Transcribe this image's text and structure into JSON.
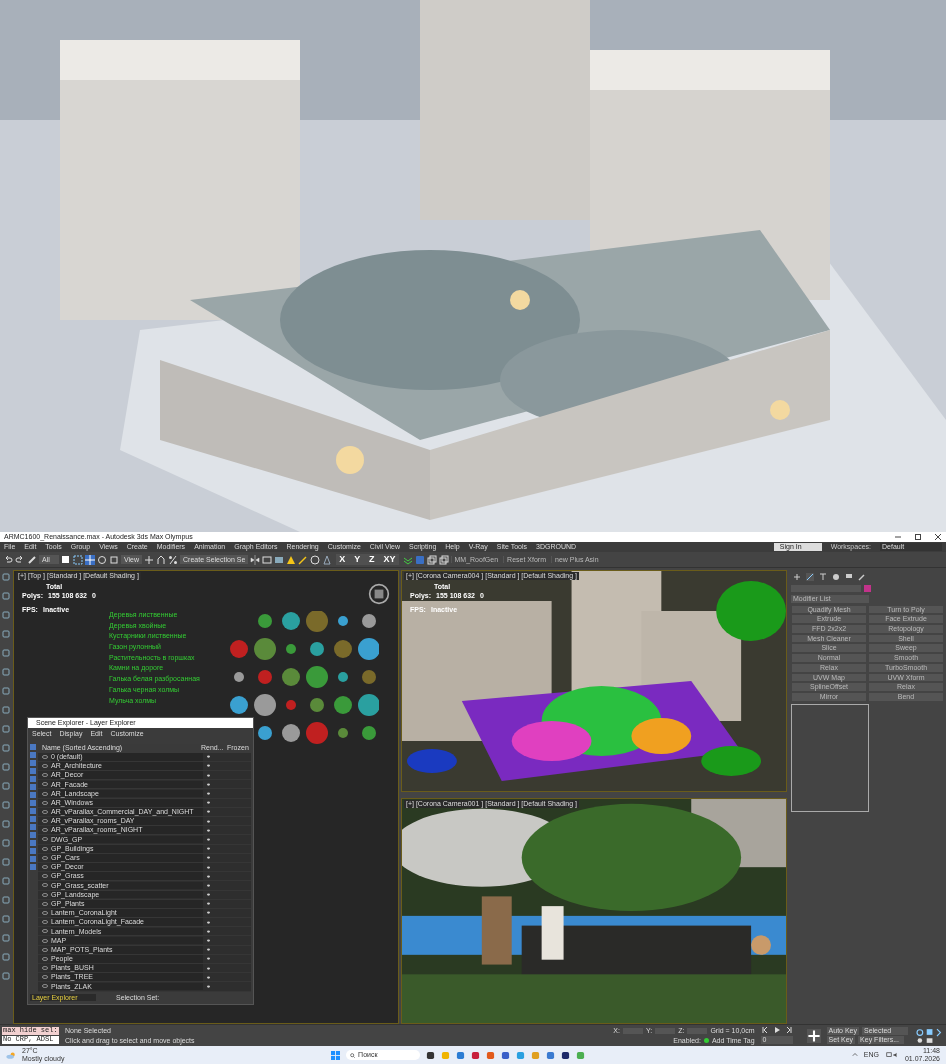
{
  "window": {
    "title": "ARMC1600_Renaissance.max - Autodesk 3ds Max Olympus"
  },
  "menu": [
    "File",
    "Edit",
    "Tools",
    "Group",
    "Views",
    "Create",
    "Modifiers",
    "Animation",
    "Graph Editors",
    "Rendering",
    "Customize",
    "Civil View",
    "Scripting",
    "Help",
    "V-Ray",
    "Site Tools",
    "3DGROUND"
  ],
  "toolbar": {
    "selection_filter": "All",
    "reference": "View",
    "named_selection": "Create Selection Se",
    "axis_constraints": "X  Y  Z  XY",
    "buttons": [
      "MM_RoofGen",
      "Reset Xform",
      "new Plus Asin"
    ]
  },
  "account": {
    "sign_in": "Sign In",
    "workspaces_label": "Workspaces:",
    "workspace": "Default"
  },
  "viewports": [
    {
      "label": "[+] [Top ] [Standard ] [Default Shading ]",
      "total": "Total",
      "polys_label": "Polys:",
      "polys": "155 108 632",
      "polys_sel": "0",
      "fps_label": "FPS:",
      "fps": "Inactive"
    },
    {
      "label": "[+] [Corona Camera004 ] [Standard ] [Default Shading ]",
      "total": "Total",
      "polys_label": "Polys:",
      "polys": "155 108 632",
      "polys_sel": "0",
      "fps_label": "FPS:",
      "fps": "Inactive"
    },
    {
      "label": "[+] [Corona Camera001 ] [Standard ] [Default Shading ]"
    }
  ],
  "plan_labels": [
    "Деревья лиственные",
    "Деревья хвойные",
    "Кустарники лиственные",
    "Газон рулонный",
    "Растительность в горшках",
    "Камни на дороге",
    "Галька белая разбросанная",
    "Галька черная холмы",
    "Мульча холмы"
  ],
  "scene_explorer": {
    "title": "Scene Explorer - Layer Explorer",
    "menu": [
      "Select",
      "Display",
      "Edit",
      "Customize"
    ],
    "columns": [
      "Name (Sorted Ascending)",
      "Rend...",
      "Frozen"
    ],
    "layers": [
      "0 (default)",
      "AR_Architecture",
      "AR_Decor",
      "AR_Facade",
      "AR_Landscape",
      "AR_Windows",
      "AR_vParallax_Commercial_DAY_and_NIGHT",
      "AR_vParallax_rooms_DAY",
      "AR_vParallax_rooms_NIGHT",
      "DWG_GP",
      "GP_Buildings",
      "GP_Cars",
      "GP_Decor",
      "GP_Grass",
      "GP_Grass_scatter",
      "GP_Landscape",
      "GP_Plants",
      "Lantern_CoronaLight",
      "Lantern_CoronaLight_Facade",
      "Lantern_Models",
      "MAP",
      "MAP_POTS_Plants",
      "People",
      "Plants_BUSH",
      "Plants_TREE",
      "Plants_ZLAK"
    ],
    "explorer_type": "Layer Explorer",
    "selection_set_label": "Selection Set:"
  },
  "command_panel": {
    "modifier_list": "Modifier List",
    "modifiers": [
      "Quadify Mesh",
      "Turn to Poly",
      "Extrude",
      "Face Extrude",
      "FFD 2x2x2",
      "Retopology",
      "Mesh Cleaner",
      "Shell",
      "Slice",
      "Sweep",
      "Normal",
      "Smooth",
      "Relax",
      "TurboSmooth",
      "UVW Map",
      "UVW Xform",
      "SplineOffset",
      "Relax",
      "Mirror",
      "Bend"
    ]
  },
  "status_bar": {
    "script_lines": [
      "max hide sel:",
      "No CRP, ADSL"
    ],
    "selection": "None Selected",
    "prompt": "Click and drag to select and move objects",
    "coords": [
      "X:",
      "Y:",
      "Z:"
    ],
    "grid": "Grid = 10,0cm",
    "enabled": "Enabled:",
    "add_time_tag": "Add Time Tag",
    "frame": "0",
    "auto_key": "Auto Key",
    "key_mode": "Selected",
    "set_key": "Set Key",
    "key_filters": "Key Filters..."
  },
  "taskbar": {
    "temperature": "27°C",
    "weather": "Mostly cloudy",
    "search_placeholder": "Поиск",
    "language": "ENG",
    "time": "11:48",
    "date": "01.07.2026"
  }
}
